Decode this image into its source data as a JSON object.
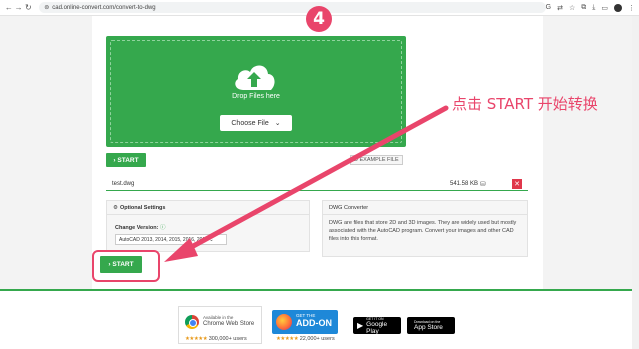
{
  "browser": {
    "url": "cad.online-convert.com/convert-to-dwg",
    "back_icon": "arrow-left-icon",
    "forward_icon": "arrow-right-icon",
    "reload_icon": "reload-icon"
  },
  "step_badge": "4",
  "dropzone": {
    "drop_text": "Drop Files here",
    "choose_label": "Choose File",
    "choose_caret": "⌄"
  },
  "start_top_label": "› START",
  "example_label": "D EXAMPLE FILE",
  "file": {
    "name": "test.dwg",
    "size": "541.58 KB",
    "remove_label": "✕"
  },
  "optional_settings": {
    "title": "Optional Settings",
    "change_label": "Change Version:",
    "change_info": "ⓘ",
    "selected_version": "AutoCAD 2013, 2014, 2015, 2016, 2017  ⌄"
  },
  "dwg_converter": {
    "title": "DWG Converter",
    "description": "DWG are files that store 2D and 3D images. They are widely used but mostly associated with the AutoCAD program. Convert your images and other CAD files into this format."
  },
  "start_bottom_label": "› START",
  "annotation": {
    "text": "点击 START 开始转换",
    "color": "#e9456b"
  },
  "footer": {
    "chrome": {
      "available_text": "Available in the",
      "store_name": "Chrome Web Store",
      "stars": "★★★★★",
      "count": "300,000+ users"
    },
    "firefox": {
      "get_the": "GET THE",
      "addon": "ADD-ON",
      "stars": "★★★★★",
      "count": "22,000+ users"
    },
    "google_play": {
      "top": "GET IT ON",
      "name": "Google Play"
    },
    "app_store": {
      "top": "Download on the",
      "name": "App Store"
    }
  },
  "colors": {
    "green": "#35a84d",
    "pink": "#e9456b",
    "red": "#e0374b"
  }
}
